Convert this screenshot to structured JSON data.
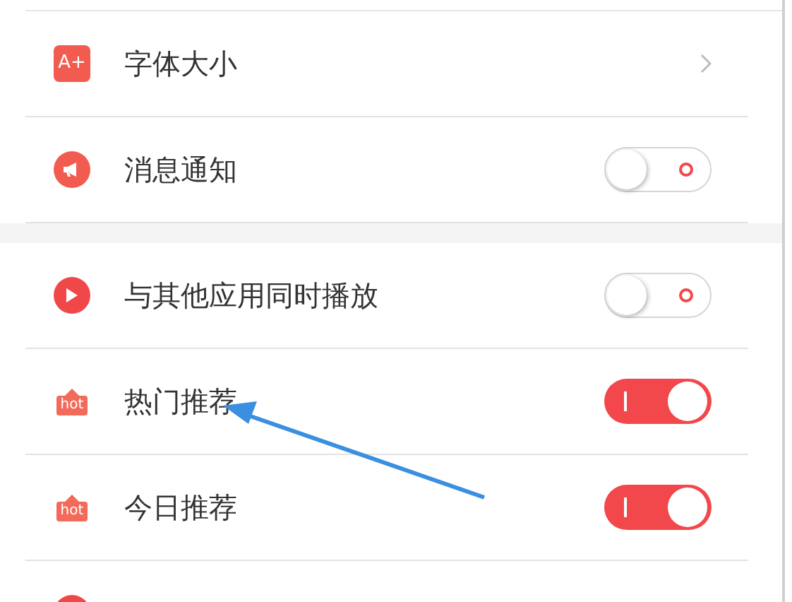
{
  "sections": [
    {
      "items": [
        {
          "kind": "link",
          "icon_text": "A+",
          "label": "字体大小"
        },
        {
          "kind": "toggle",
          "label": "消息通知",
          "on": false
        }
      ]
    },
    {
      "items": [
        {
          "kind": "toggle",
          "label": "与其他应用同时播放",
          "on": false
        },
        {
          "kind": "toggle",
          "icon_text": "hot",
          "label": "热门推荐",
          "on": true
        },
        {
          "kind": "toggle",
          "icon_text": "hot",
          "label": "今日推荐",
          "on": true
        },
        {
          "kind": "partial"
        }
      ]
    }
  ]
}
